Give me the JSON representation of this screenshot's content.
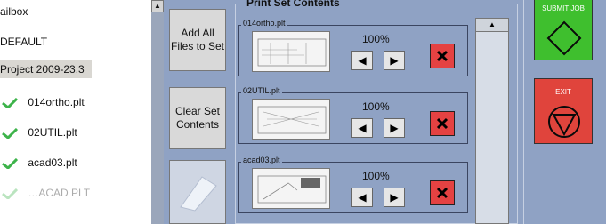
{
  "tree": {
    "items": [
      {
        "label": "ailbox"
      },
      {
        "label": "DEFAULT"
      },
      {
        "label": "Project 2009-23.3"
      },
      {
        "label": "014ortho.plt",
        "checked": true
      },
      {
        "label": "02UTIL.plt",
        "checked": true
      },
      {
        "label": "acad03.plt",
        "checked": true
      },
      {
        "label": "…ACAD PLT",
        "checked": true
      }
    ]
  },
  "left_buttons": {
    "add_all": "Add All Files to Set",
    "clear": "Clear Set Contents"
  },
  "print_set": {
    "title": "Print Set Contents",
    "files": [
      {
        "name": "014ortho.plt",
        "scale": "100%"
      },
      {
        "name": "02UTIL.plt",
        "scale": "100%"
      },
      {
        "name": "acad03.plt",
        "scale": "100%"
      }
    ]
  },
  "right_buttons": {
    "submit": "SUBMIT JOB",
    "exit": "EXIT"
  },
  "colors": {
    "panel": "#8fa2c4",
    "submit": "#3fbf2e",
    "exit": "#e0443c",
    "delete": "#e44242",
    "check": "#3db34a"
  }
}
